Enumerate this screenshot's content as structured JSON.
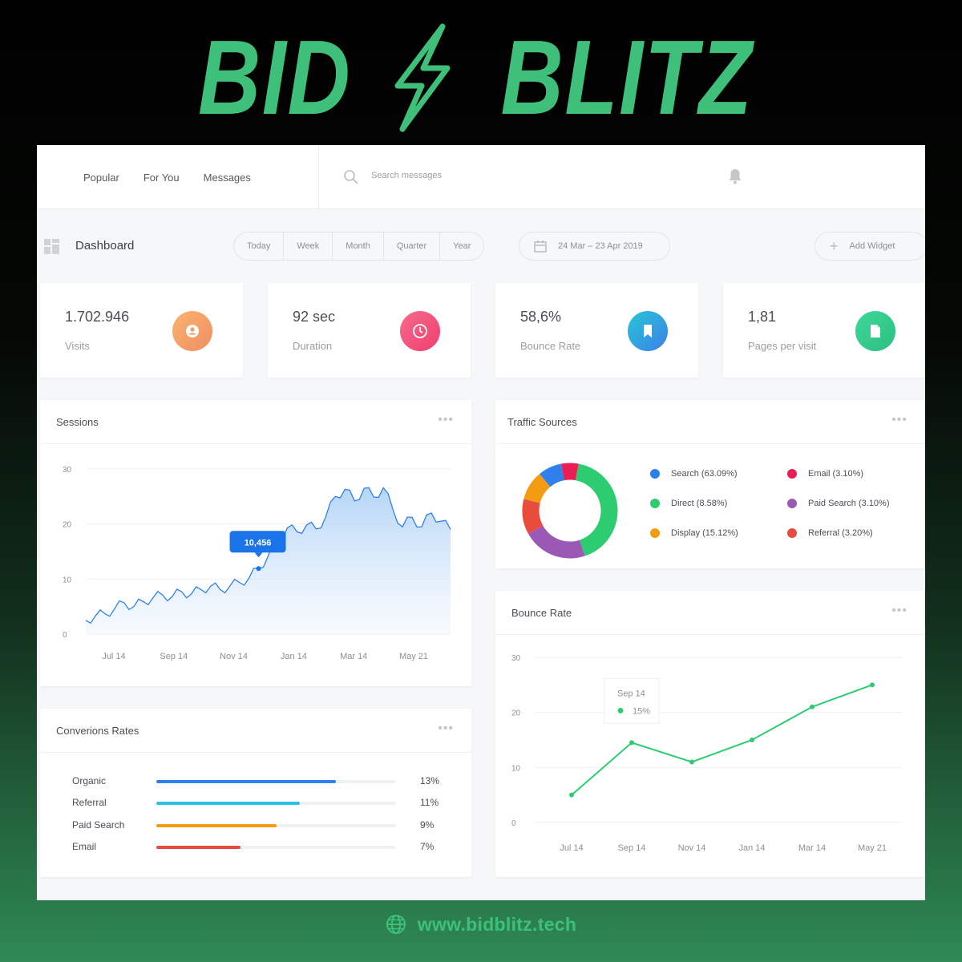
{
  "logo": {
    "word1": "BID",
    "word2": "BLITZ"
  },
  "colors": {
    "brand_green": "#3ec07a",
    "accent_blue": "#2f80ed",
    "line_green": "#2ecc71"
  },
  "topbar": {
    "nav": [
      "Popular",
      "For You",
      "Messages"
    ],
    "search_placeholder": "Search messages",
    "icons": [
      "search-icon",
      "bell-icon"
    ]
  },
  "toolbar": {
    "title": "Dashboard",
    "ranges": [
      "Today",
      "Week",
      "Month",
      "Quarter",
      "Year"
    ],
    "date_range": "24 Mar – 23 Apr 2019",
    "add_widget": "Add Widget"
  },
  "stats": [
    {
      "value": "1.702.946",
      "label": "Visits",
      "icon": "user-icon",
      "color": "#f5a263"
    },
    {
      "value": "92 sec",
      "label": "Duration",
      "icon": "clock-icon",
      "color": "#f3537a"
    },
    {
      "value": "58,6%",
      "label": "Bounce Rate",
      "icon": "bookmark-icon",
      "color": "#2a9bd8"
    },
    {
      "value": "1,81",
      "label": "Pages per visit",
      "icon": "document-icon",
      "color": "#35c98a"
    }
  ],
  "sessions": {
    "title": "Sessions",
    "menu": "•••",
    "tooltip": "10,456"
  },
  "traffic": {
    "title": "Traffic Sources",
    "menu": "•••",
    "items": [
      {
        "label": "Search (63.09%)",
        "color": "#2f80ed"
      },
      {
        "label": "Direct (8.58%)",
        "color": "#2ecc71"
      },
      {
        "label": "Display (15.12%)",
        "color": "#f39c12"
      },
      {
        "label": "Email (3.10%)",
        "color": "#e91e55"
      },
      {
        "label": "Paid Search (3.10%)",
        "color": "#9b59b6"
      },
      {
        "label": "Referral (3.20%)",
        "color": "#e74c3c"
      }
    ]
  },
  "conversions": {
    "title": "Converions Rates",
    "menu": "•••",
    "rows": [
      {
        "label": "Organic",
        "value": "13%",
        "fraction": 0.75,
        "color": "#2f80ed"
      },
      {
        "label": "Referral",
        "value": "11%",
        "fraction": 0.6,
        "color": "#29c1e6"
      },
      {
        "label": "Paid Search",
        "value": "9%",
        "fraction": 0.5,
        "color": "#f39c12"
      },
      {
        "label": "Email",
        "value": "7%",
        "fraction": 0.35,
        "color": "#e74c3c"
      }
    ]
  },
  "bounce": {
    "title": "Bounce Rate",
    "menu": "•••",
    "tooltip_date": "Sep 14",
    "tooltip_value": "15%"
  },
  "chart_data": [
    {
      "type": "area",
      "title": "Sessions",
      "x_ticks": [
        "Jul 14",
        "Sep 14",
        "Nov 14",
        "Jan 14",
        "Mar 14",
        "May 21"
      ],
      "y_ticks": [
        "0",
        "10",
        "20",
        "30"
      ],
      "ylim": [
        0,
        30
      ],
      "grid": true,
      "series": [
        {
          "values": [
            2.5,
            3.3,
            3.7,
            4.6,
            5.7,
            5.0,
            5.9,
            6.6,
            7.1,
            6.8,
            7.7,
            7.3,
            8.1,
            8.7,
            8.1,
            8.7,
            9.4,
            10.2,
            11.9,
            14.2,
            17.1,
            19.3,
            18.6,
            19.8,
            19.1,
            21.3,
            25.0,
            26.3,
            24.2,
            26.5,
            24.9,
            26.6,
            22.6,
            19.5,
            21.2,
            19.5,
            22.0,
            20.5,
            19.0
          ]
        }
      ],
      "highlight": {
        "x_index": 18,
        "label": "10,456"
      }
    },
    {
      "type": "pie",
      "title": "Traffic Sources",
      "categories": [
        "Search",
        "Direct",
        "Display",
        "Email",
        "Paid Search",
        "Referral"
      ],
      "values": [
        63.09,
        8.58,
        15.12,
        3.1,
        3.1,
        3.2
      ],
      "colors": [
        "#2f80ed",
        "#2ecc71",
        "#f39c12",
        "#e91e55",
        "#9b59b6",
        "#e74c3c"
      ]
    },
    {
      "type": "bar",
      "title": "Converions Rates",
      "categories": [
        "Organic",
        "Referral",
        "Paid Search",
        "Email"
      ],
      "values": [
        13,
        11,
        9,
        7
      ]
    },
    {
      "type": "line",
      "title": "Bounce Rate",
      "x_ticks": [
        "Jul 14",
        "Sep 14",
        "Nov 14",
        "Jan 14",
        "Mar 14",
        "May 21"
      ],
      "y_ticks": [
        "0",
        "10",
        "20",
        "30"
      ],
      "ylim": [
        0,
        30
      ],
      "grid": true,
      "series": [
        {
          "values": [
            5,
            14.5,
            11,
            15,
            21,
            25
          ]
        }
      ]
    }
  ],
  "footer": {
    "url": "www.bidblitz.tech",
    "icon": "globe-icon"
  }
}
